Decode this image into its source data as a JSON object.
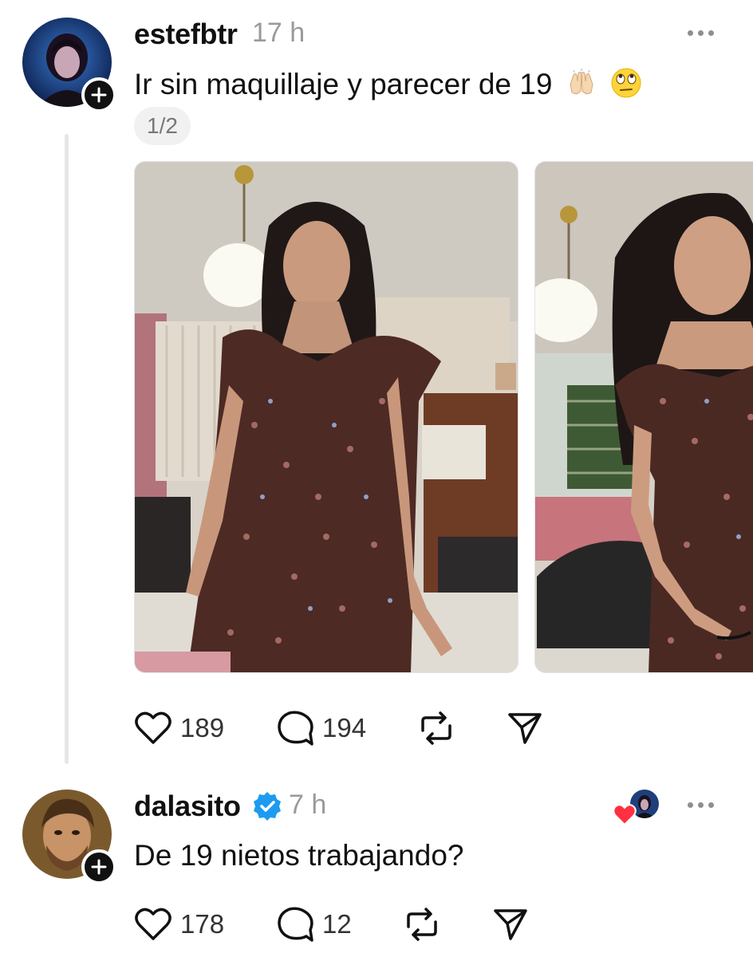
{
  "post": {
    "username": "estefbtr",
    "time": "17 h",
    "text": "Ir sin maquillaje y parecer de 19",
    "emojis": [
      "raising-hands-emoji",
      "face-with-rolling-eyes-emoji"
    ],
    "pager": "1/2",
    "likes": "189",
    "replies": "194",
    "photos": [
      "photo-1",
      "photo-2"
    ]
  },
  "reply": {
    "username": "dalasito",
    "verified": true,
    "time": "7 h",
    "text": "De 19 nietos trabajando?",
    "likes": "178",
    "replies": "12"
  },
  "colors": {
    "verified_blue": "#1d9bf0",
    "like_red": "#ff3040",
    "muted": "#9a9a9a"
  }
}
